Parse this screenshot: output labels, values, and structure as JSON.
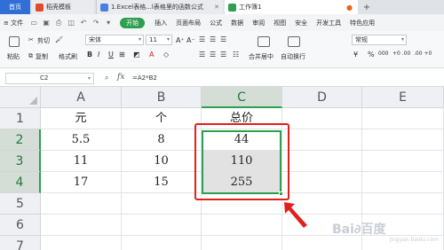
{
  "tabs": {
    "home": "首页",
    "templates": "稻壳模板",
    "doc": "1.Excel表格...l表格里的函数公式",
    "book": "工作簿1",
    "new_tab": "+"
  },
  "menu": {
    "file": "≡ 文件",
    "start": "开始",
    "insert": "插入",
    "page_layout": "页面布局",
    "formulas": "公式",
    "data": "数据",
    "review": "审阅",
    "view": "视图",
    "security": "安全",
    "dev_tools": "开发工具",
    "features": "特色应用"
  },
  "toolbar": {
    "paste": "粘贴",
    "cut": "剪切",
    "copy": "复制",
    "format_painter": "格式刷",
    "font_name": "宋体",
    "font_size": "11",
    "bold": "B",
    "italic": "I",
    "underline": "U",
    "merge_center": "合并居中",
    "wrap_text": "自动换行",
    "number_format": "常规",
    "currency": "¥",
    "percent": "%",
    "thousands": "000",
    "inc_decimal": "+0 .00",
    "dec_decimal": ".00 +0"
  },
  "formula_bar": {
    "cell_ref": "C2",
    "fx": "fx",
    "formula": "=A2*B2"
  },
  "sheet": {
    "columns": [
      "A",
      "B",
      "C",
      "D",
      "E"
    ],
    "rows": [
      "1",
      "2",
      "3",
      "4",
      "5",
      "6",
      "7"
    ],
    "data": [
      [
        "元",
        "个",
        "总价",
        "",
        ""
      ],
      [
        "5.5",
        "8",
        "44",
        "",
        ""
      ],
      [
        "11",
        "10",
        "110",
        "",
        ""
      ],
      [
        "17",
        "15",
        "255",
        "",
        ""
      ]
    ],
    "active_column": "C",
    "selected_range": "C2:C4"
  },
  "colors": {
    "accent_green": "#2e9e4f",
    "tab_blue": "#2f6fd6",
    "annotation_red": "#e0201b"
  },
  "watermark": {
    "logo": "Bai∂百度",
    "sub": "jingyan.baidu.com"
  }
}
